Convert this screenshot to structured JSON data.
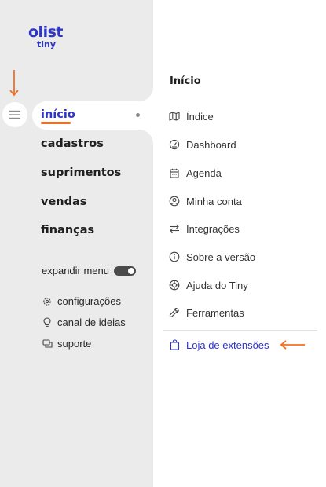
{
  "brand": {
    "name": "olist",
    "product": "tiny",
    "color": "#2e36c8"
  },
  "accent_orange": "#f37021",
  "menu_button": {
    "icon": "hamburger-icon"
  },
  "nav": {
    "active": "início",
    "items": [
      "início",
      "cadastros",
      "suprimentos",
      "vendas",
      "finanças"
    ]
  },
  "expand_menu": {
    "label": "expandir menu",
    "toggled": true
  },
  "utilities": [
    {
      "label": "configurações",
      "icon": "gear-icon"
    },
    {
      "label": "canal de ideias",
      "icon": "lightbulb-icon"
    },
    {
      "label": "suporte",
      "icon": "chat-icon"
    }
  ],
  "panel": {
    "title": "Início",
    "items": [
      {
        "label": "Índice",
        "icon": "map-icon"
      },
      {
        "label": "Dashboard",
        "icon": "gauge-icon"
      },
      {
        "label": "Agenda",
        "icon": "calendar-icon"
      },
      {
        "label": "Minha conta",
        "icon": "user-icon"
      },
      {
        "label": "Integrações",
        "icon": "swap-arrows-icon"
      },
      {
        "label": "Sobre a versão",
        "icon": "info-icon"
      },
      {
        "label": "Ajuda do Tiny",
        "icon": "lifebuoy-icon"
      },
      {
        "label": "Ferramentas",
        "icon": "wrench-icon"
      }
    ],
    "featured": {
      "label": "Loja de extensões",
      "icon": "shopping-bag-icon"
    }
  }
}
